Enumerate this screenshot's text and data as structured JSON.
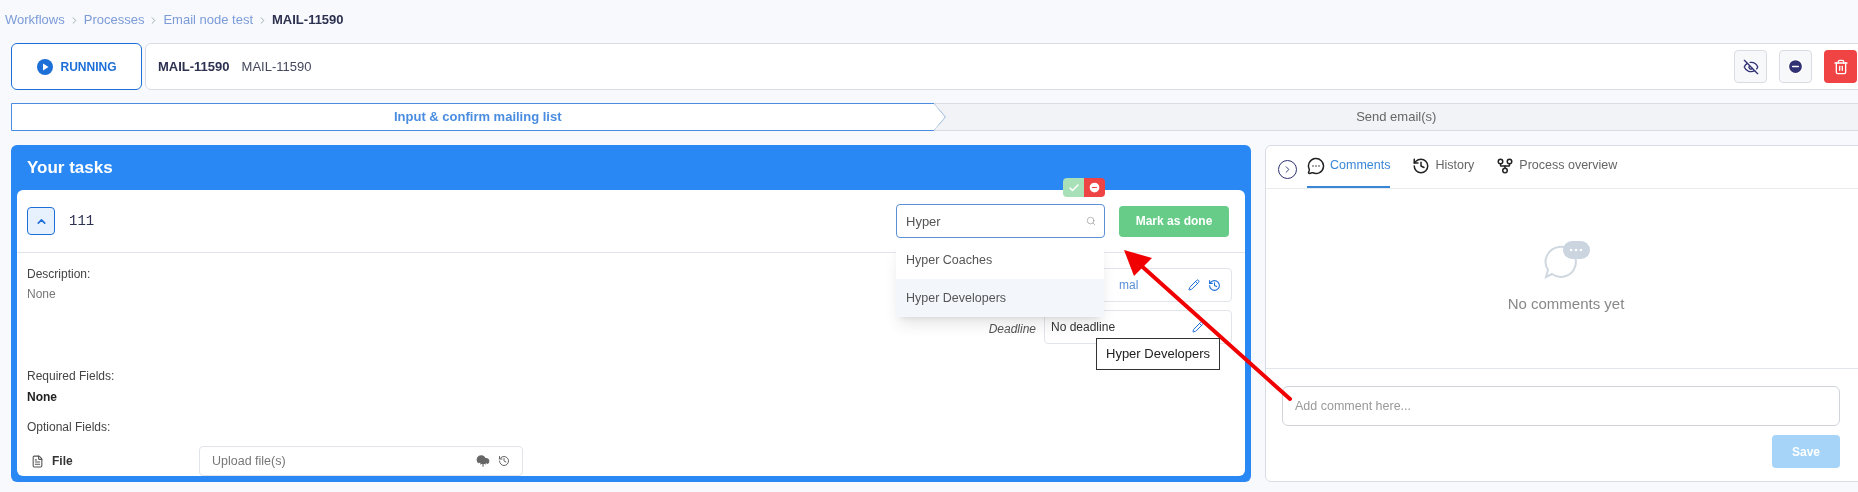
{
  "breadcrumb": [
    {
      "label": "Workflows",
      "current": false
    },
    {
      "label": "Processes",
      "current": false
    },
    {
      "label": "Email node test",
      "current": false
    },
    {
      "label": "MAIL-11590",
      "current": true
    }
  ],
  "process": {
    "status": "RUNNING",
    "id": "MAIL-11590",
    "name": "MAIL-11590"
  },
  "steps": [
    {
      "label": "Input & confirm mailing list",
      "selected": true
    },
    {
      "label": "Send email(s)",
      "selected": false
    }
  ],
  "tasks_panel": {
    "title": "Your tasks",
    "task": {
      "name": "111",
      "expanded": true,
      "search": {
        "value": "Hyper",
        "options": [
          {
            "label": "Hyper Coaches",
            "selected": false
          },
          {
            "label": "Hyper Developers",
            "selected": true
          }
        ]
      },
      "mark_done": "Mark as done",
      "description_label": "Description:",
      "description": "None",
      "priority_value": "mal",
      "deadline_label": "Deadline",
      "deadline_value": "No deadline",
      "tooltip": "Hyper Developers",
      "required_label": "Required Fields:",
      "required": "None",
      "optional_label": "Optional Fields:",
      "fields": [
        {
          "label": "File",
          "placeholder": "Upload file(s)"
        }
      ]
    }
  },
  "side_panel": {
    "tabs": [
      {
        "label": "Comments",
        "kind": "comments",
        "selected": true
      },
      {
        "label": "History",
        "kind": "history",
        "selected": false
      },
      {
        "label": "Process overview",
        "kind": "overview",
        "selected": false
      }
    ],
    "empty_text": "No comments yet",
    "comment": {
      "placeholder": "Add comment here..."
    },
    "save": {
      "label": "Save",
      "disabled": true
    }
  }
}
